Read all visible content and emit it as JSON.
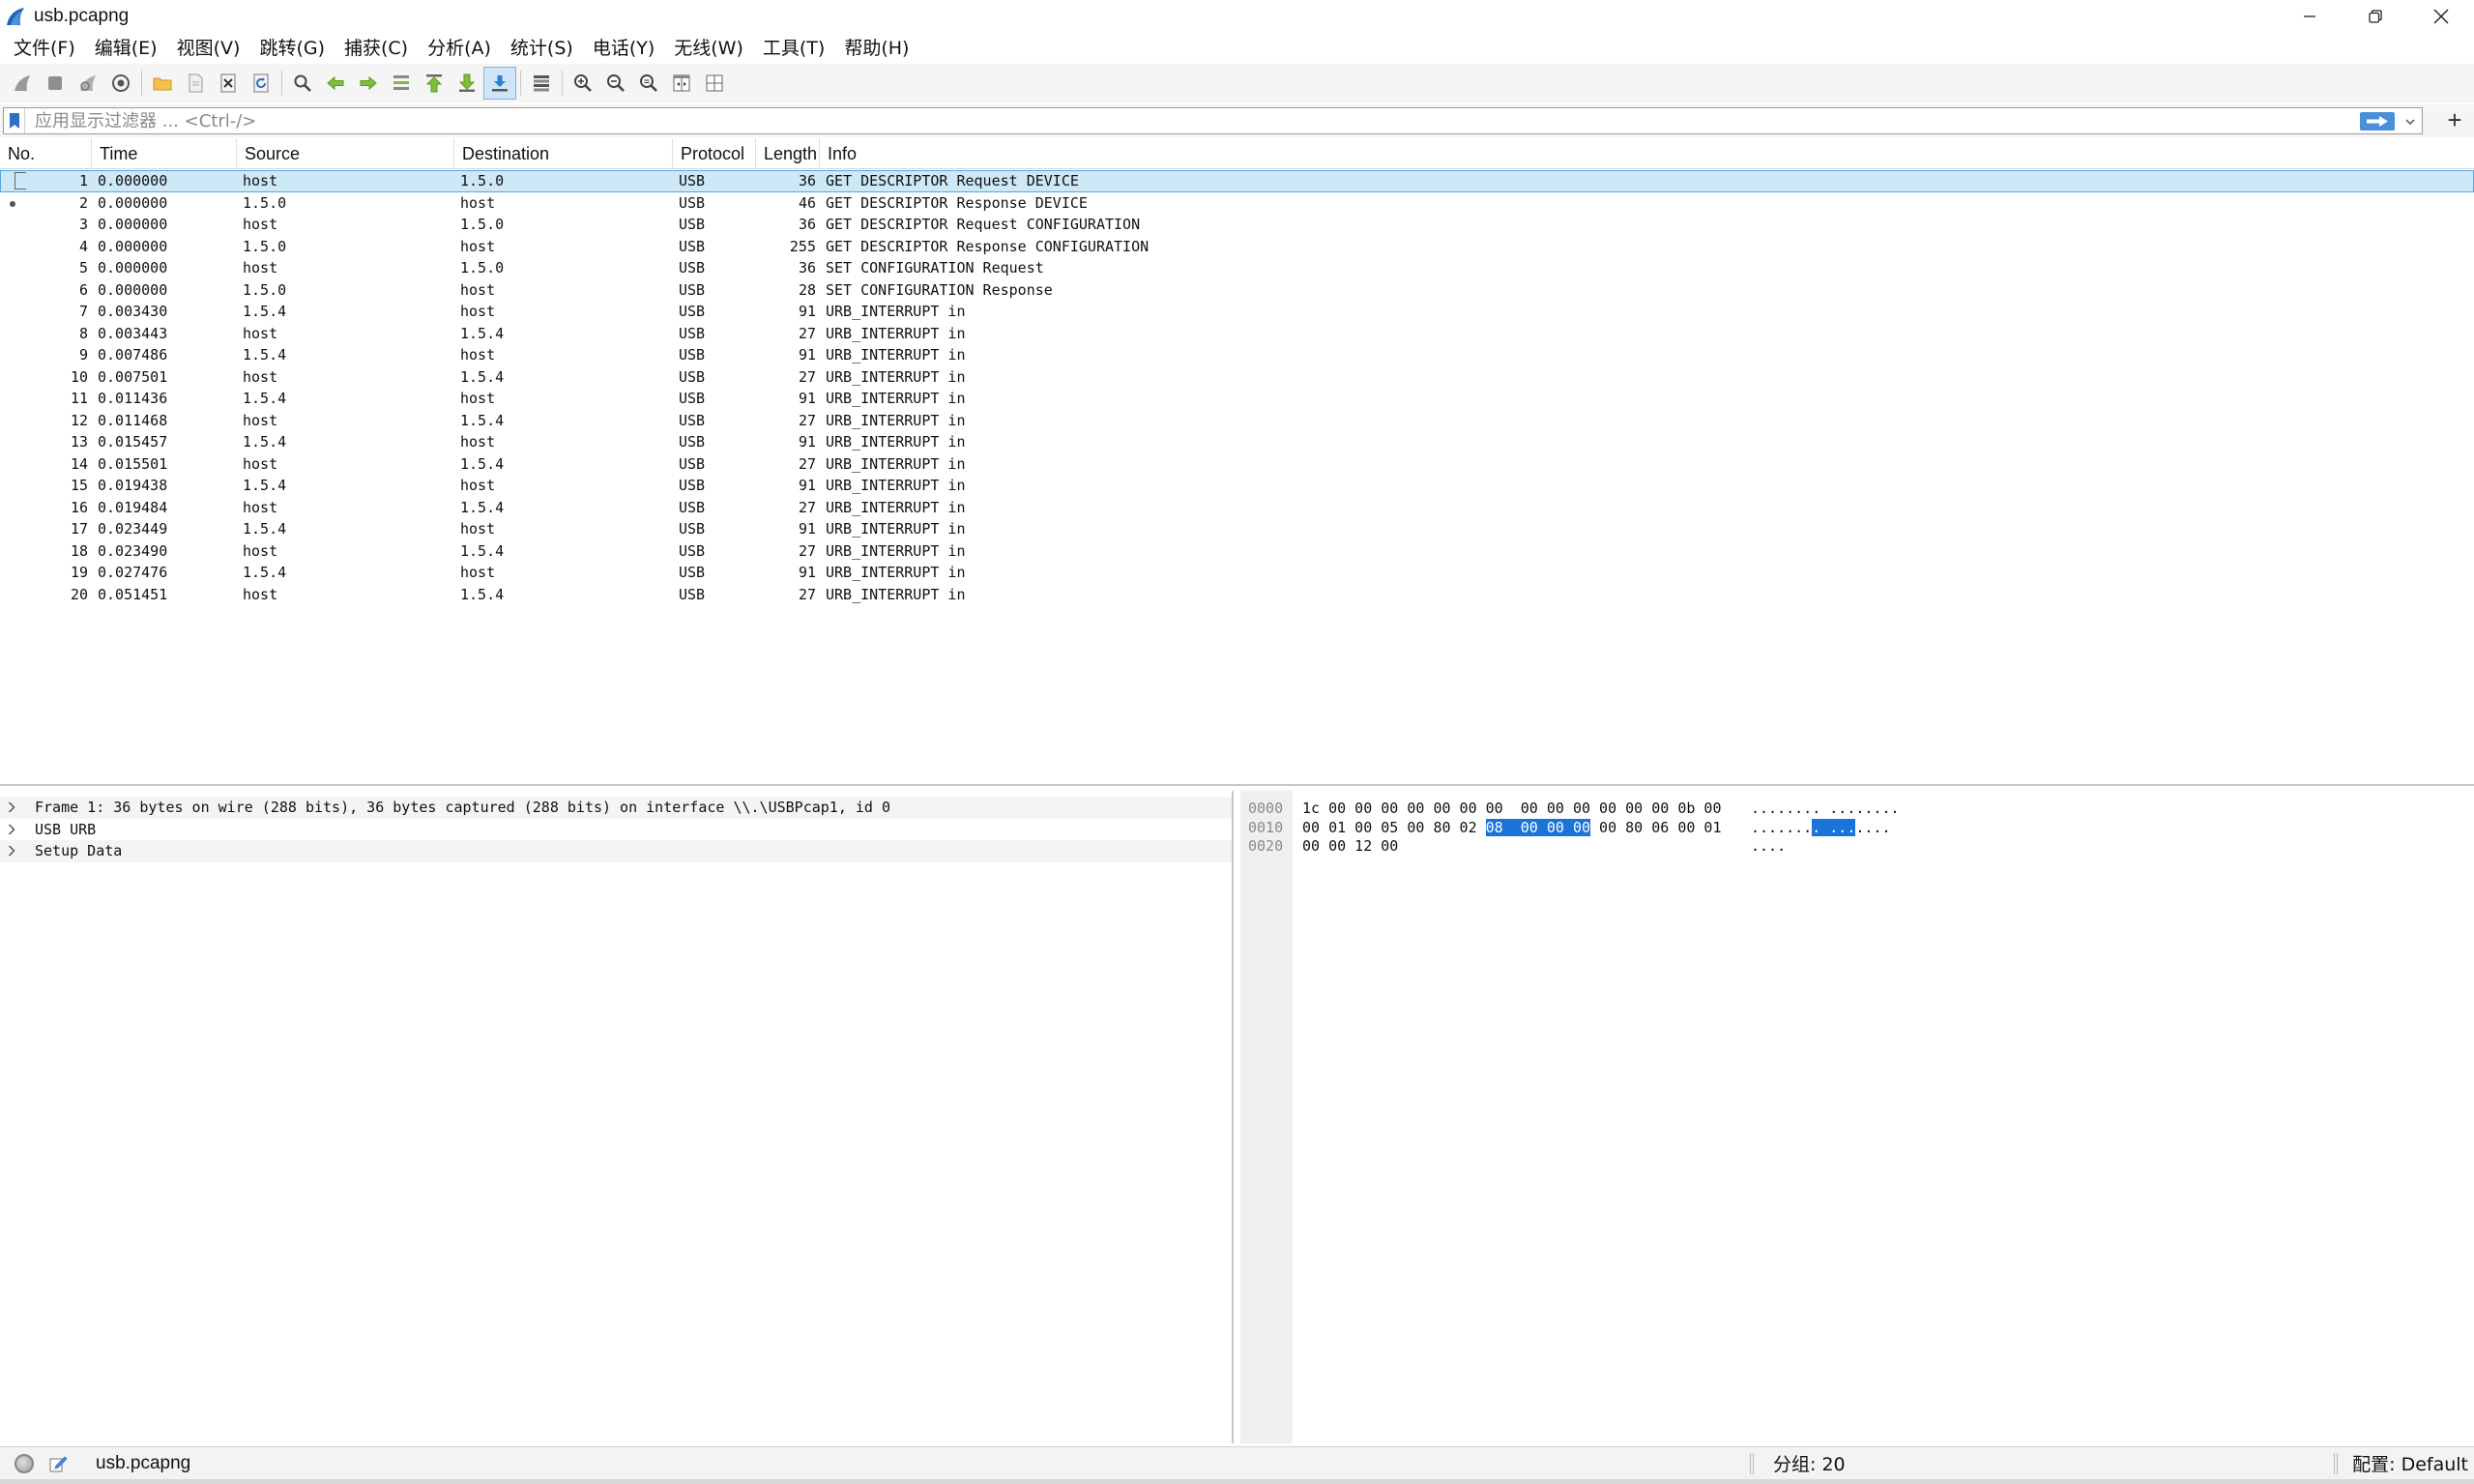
{
  "window": {
    "title": "usb.pcapng"
  },
  "menu": [
    "文件(F)",
    "编辑(E)",
    "视图(V)",
    "跳转(G)",
    "捕获(C)",
    "分析(A)",
    "统计(S)",
    "电话(Y)",
    "无线(W)",
    "工具(T)",
    "帮助(H)"
  ],
  "toolbar": {
    "icons": [
      "shark-fin-start-icon",
      "stop-capture-icon",
      "restart-capture-icon",
      "capture-options-icon",
      "open-file-icon",
      "save-file-icon",
      "close-file-icon",
      "reload-file-icon",
      "find-packet-icon",
      "go-back-icon",
      "go-forward-icon",
      "go-to-packet-icon",
      "first-packet-icon",
      "last-packet-icon",
      "autoscroll-icon",
      "colorize-icon",
      "zoom-in-icon",
      "zoom-out-icon",
      "zoom-normal-icon",
      "resize-columns-icon",
      "layout-icon"
    ],
    "active": "autoscroll-icon"
  },
  "filter": {
    "placeholder": "应用显示过滤器 ... <Ctrl-/>",
    "value": "",
    "add_label": "+"
  },
  "packet_list": {
    "columns": [
      "No.",
      "Time",
      "Source",
      "Destination",
      "Protocol",
      "Length",
      "Info"
    ],
    "selected_index": 0,
    "rows": [
      {
        "no": "1",
        "time": "0.000000",
        "src": "host",
        "dst": "1.5.0",
        "proto": "USB",
        "len": "36",
        "info": "GET DESCRIPTOR Request DEVICE"
      },
      {
        "no": "2",
        "time": "0.000000",
        "src": "1.5.0",
        "dst": "host",
        "proto": "USB",
        "len": "46",
        "info": "GET DESCRIPTOR Response DEVICE"
      },
      {
        "no": "3",
        "time": "0.000000",
        "src": "host",
        "dst": "1.5.0",
        "proto": "USB",
        "len": "36",
        "info": "GET DESCRIPTOR Request CONFIGURATION"
      },
      {
        "no": "4",
        "time": "0.000000",
        "src": "1.5.0",
        "dst": "host",
        "proto": "USB",
        "len": "255",
        "info": "GET DESCRIPTOR Response CONFIGURATION"
      },
      {
        "no": "5",
        "time": "0.000000",
        "src": "host",
        "dst": "1.5.0",
        "proto": "USB",
        "len": "36",
        "info": "SET CONFIGURATION Request"
      },
      {
        "no": "6",
        "time": "0.000000",
        "src": "1.5.0",
        "dst": "host",
        "proto": "USB",
        "len": "28",
        "info": "SET CONFIGURATION Response"
      },
      {
        "no": "7",
        "time": "0.003430",
        "src": "1.5.4",
        "dst": "host",
        "proto": "USB",
        "len": "91",
        "info": "URB_INTERRUPT in"
      },
      {
        "no": "8",
        "time": "0.003443",
        "src": "host",
        "dst": "1.5.4",
        "proto": "USB",
        "len": "27",
        "info": "URB_INTERRUPT in"
      },
      {
        "no": "9",
        "time": "0.007486",
        "src": "1.5.4",
        "dst": "host",
        "proto": "USB",
        "len": "91",
        "info": "URB_INTERRUPT in"
      },
      {
        "no": "10",
        "time": "0.007501",
        "src": "host",
        "dst": "1.5.4",
        "proto": "USB",
        "len": "27",
        "info": "URB_INTERRUPT in"
      },
      {
        "no": "11",
        "time": "0.011436",
        "src": "1.5.4",
        "dst": "host",
        "proto": "USB",
        "len": "91",
        "info": "URB_INTERRUPT in"
      },
      {
        "no": "12",
        "time": "0.011468",
        "src": "host",
        "dst": "1.5.4",
        "proto": "USB",
        "len": "27",
        "info": "URB_INTERRUPT in"
      },
      {
        "no": "13",
        "time": "0.015457",
        "src": "1.5.4",
        "dst": "host",
        "proto": "USB",
        "len": "91",
        "info": "URB_INTERRUPT in"
      },
      {
        "no": "14",
        "time": "0.015501",
        "src": "host",
        "dst": "1.5.4",
        "proto": "USB",
        "len": "27",
        "info": "URB_INTERRUPT in"
      },
      {
        "no": "15",
        "time": "0.019438",
        "src": "1.5.4",
        "dst": "host",
        "proto": "USB",
        "len": "91",
        "info": "URB_INTERRUPT in"
      },
      {
        "no": "16",
        "time": "0.019484",
        "src": "host",
        "dst": "1.5.4",
        "proto": "USB",
        "len": "27",
        "info": "URB_INTERRUPT in"
      },
      {
        "no": "17",
        "time": "0.023449",
        "src": "1.5.4",
        "dst": "host",
        "proto": "USB",
        "len": "91",
        "info": "URB_INTERRUPT in"
      },
      {
        "no": "18",
        "time": "0.023490",
        "src": "host",
        "dst": "1.5.4",
        "proto": "USB",
        "len": "27",
        "info": "URB_INTERRUPT in"
      },
      {
        "no": "19",
        "time": "0.027476",
        "src": "1.5.4",
        "dst": "host",
        "proto": "USB",
        "len": "91",
        "info": "URB_INTERRUPT in"
      },
      {
        "no": "20",
        "time": "0.051451",
        "src": "host",
        "dst": "1.5.4",
        "proto": "USB",
        "len": "27",
        "info": "URB_INTERRUPT in"
      }
    ]
  },
  "details": [
    "Frame 1: 36 bytes on wire (288 bits), 36 bytes captured (288 bits) on interface \\\\.\\USBPcap1, id 0",
    "USB URB",
    "Setup Data"
  ],
  "bytes": [
    {
      "offset": "0000",
      "hex_pre": "1c 00 00 00 00 00 00 00  00 00 00 00 00 00 0b 00",
      "hex_hl": "",
      "hex_post": "",
      "asc_pre": "........ ........",
      "asc_hl": "",
      "asc_post": ""
    },
    {
      "offset": "0010",
      "hex_pre": "00 01 00 05 00 80 02 ",
      "hex_hl": "08  00 00 00",
      "hex_post": " 00 80 06 00 01",
      "asc_pre": ".......",
      "asc_hl": ". ...",
      "asc_post": "...."
    },
    {
      "offset": "0020",
      "hex_pre": "00 00 12 00",
      "hex_hl": "",
      "hex_post": "",
      "asc_pre": "....",
      "asc_hl": "",
      "asc_post": ""
    }
  ],
  "status": {
    "file": "usb.pcapng",
    "packets": "分组: 20",
    "profile": "配置: Default"
  },
  "colors": {
    "selected_row": "#cde8f7",
    "byte_highlight": "#1a73d9",
    "toolbar_bg": "#f5f5f5"
  }
}
